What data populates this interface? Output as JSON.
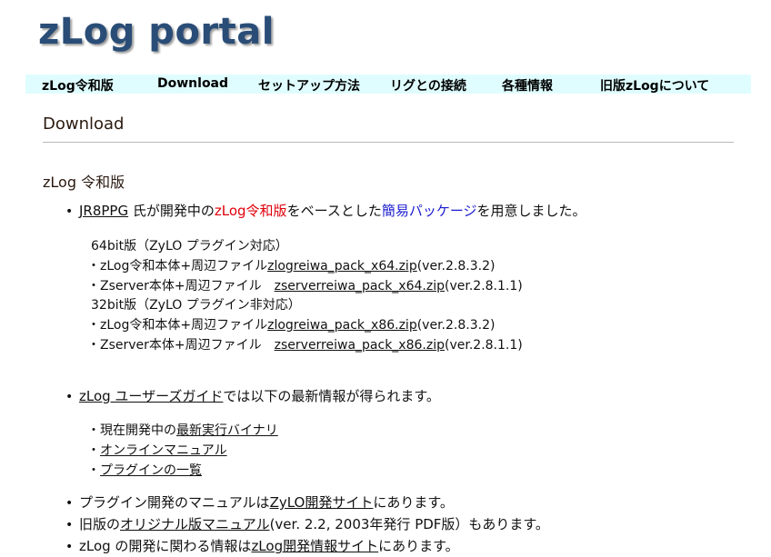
{
  "header": {
    "logo_text": "zLog portal"
  },
  "nav": {
    "items": [
      {
        "label": "zLog令和版"
      },
      {
        "label": "Download"
      },
      {
        "label": "セットアップ方法"
      },
      {
        "label": "リグとの接続"
      },
      {
        "label": "各種情報"
      },
      {
        "label": "旧版zLogについて"
      }
    ]
  },
  "page": {
    "title": "Download",
    "section_title": "zLog 令和版"
  },
  "intro": {
    "author_link": "JR8PPG",
    "text1": " 氏が開発中の",
    "highlight_red": "zLog令和版",
    "text2": "をベースとした",
    "highlight_blue": "簡易パッケージ",
    "text3": "を用意しました。"
  },
  "downloads": {
    "group64_heading": "64bit版（ZyLO プラグイン対応）",
    "group32_heading": "32bit版（ZyLO プラグイン非対応）",
    "rows": [
      {
        "prefix": "・zLog令和本体+周辺ファイル",
        "link": "zlogreiwa_pack_x64.zip",
        "ver": "(ver.2.8.3.2)"
      },
      {
        "prefix": "・Zserver本体+周辺ファイル　",
        "link": "zserverreiwa_pack_x64.zip",
        "ver": "(ver.2.8.1.1)"
      },
      {
        "prefix": "・zLog令和本体+周辺ファイル",
        "link": "zlogreiwa_pack_x86.zip",
        "ver": "(ver.2.8.3.2)"
      },
      {
        "prefix": "・Zserver本体+周辺ファイル　",
        "link": "zserverreiwa_pack_x86.zip",
        "ver": "(ver.2.8.1.1)"
      }
    ]
  },
  "guide": {
    "link": "zLog ユーザーズガイド",
    "text": "では以下の最新情報が得られます。",
    "items": [
      {
        "prefix": "・現在開発中の",
        "link": "最新実行バイナリ"
      },
      {
        "prefix": "・",
        "link": "オンラインマニュアル"
      },
      {
        "prefix": "・",
        "link": "プラグインの一覧"
      }
    ]
  },
  "more": {
    "plugin_prefix": "プラグイン開発のマニュアルは",
    "plugin_link": "ZyLO開発サイト",
    "plugin_suffix": "にあります。",
    "old_prefix": "旧版の",
    "old_link": "オリジナル版マニュアル",
    "old_suffix": "(ver. 2.2, 2003年発行 PDF版）もあります。",
    "dev_prefix": "zLog の開発に関わる情報は",
    "dev_link": "zLog開発情報サイト",
    "dev_suffix": "にあります。"
  },
  "bullet_glyph": "•",
  "colors": {
    "logo": "#2a4d77",
    "nav_bg": "#dffdfe",
    "red": "#e0000a",
    "blue": "#1b1bd0"
  }
}
